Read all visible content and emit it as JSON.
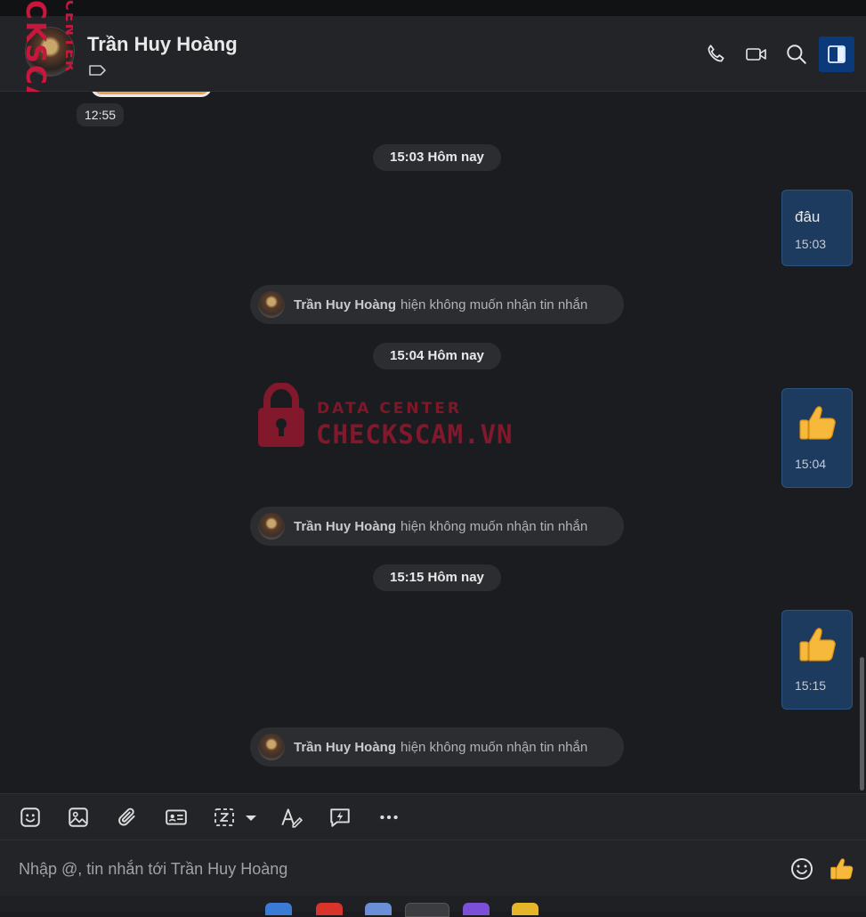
{
  "header": {
    "contact_name": "Trần Huy Hoàng"
  },
  "messages": {
    "prev_time": "12:55",
    "groups": [
      {
        "date_label": "15:03 Hôm nay",
        "bubble_text": "đâu",
        "bubble_time": "15:03"
      },
      {
        "date_label": "15:04 Hôm nay",
        "bubble_time": "15:04"
      },
      {
        "date_label": "15:15 Hôm nay",
        "bubble_time": "15:15"
      }
    ],
    "system_name": "Trần Huy Hoàng",
    "system_text": "hiện không muốn nhận tin nhắn"
  },
  "watermark": {
    "vertical_text": "CKSCAM.VN",
    "vertical_sub": "CENTER",
    "center_sub": "DATA CENTER",
    "center_main": "CHECKSCAM.VN"
  },
  "composer": {
    "placeholder": "Nhập @, tin nhắn tới Trần Huy Hoàng"
  },
  "colors": {
    "accent": "#0b3a7a",
    "bubble": "#1d3a5f",
    "watermark": "#c8163c"
  }
}
